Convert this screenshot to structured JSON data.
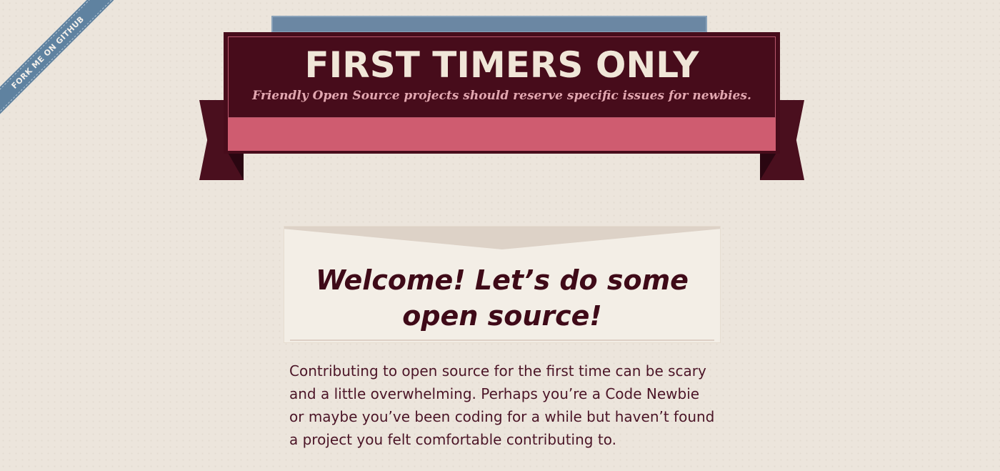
{
  "ribbon": {
    "label": "FORK ME ON GITHUB"
  },
  "header": {
    "title": "FIRST TIMERS ONLY",
    "tagline": "Friendly Open Source projects should reserve specific issues for newbies."
  },
  "welcome": {
    "heading": "Welcome! Let’s do some open source!",
    "intro": "Contributing to open source for the first time can be scary and a little overwhelming. Perhaps you’re a Code Newbie or maybe you’ve been coding for a while but haven’t found a project you felt comfortable contributing to."
  },
  "colors": {
    "background": "#ece5dc",
    "banner_dark": "#470c1b",
    "banner_pink": "#cf5c70",
    "ribbon_blue": "#5f82a0",
    "heading_text": "#3f0a18"
  }
}
